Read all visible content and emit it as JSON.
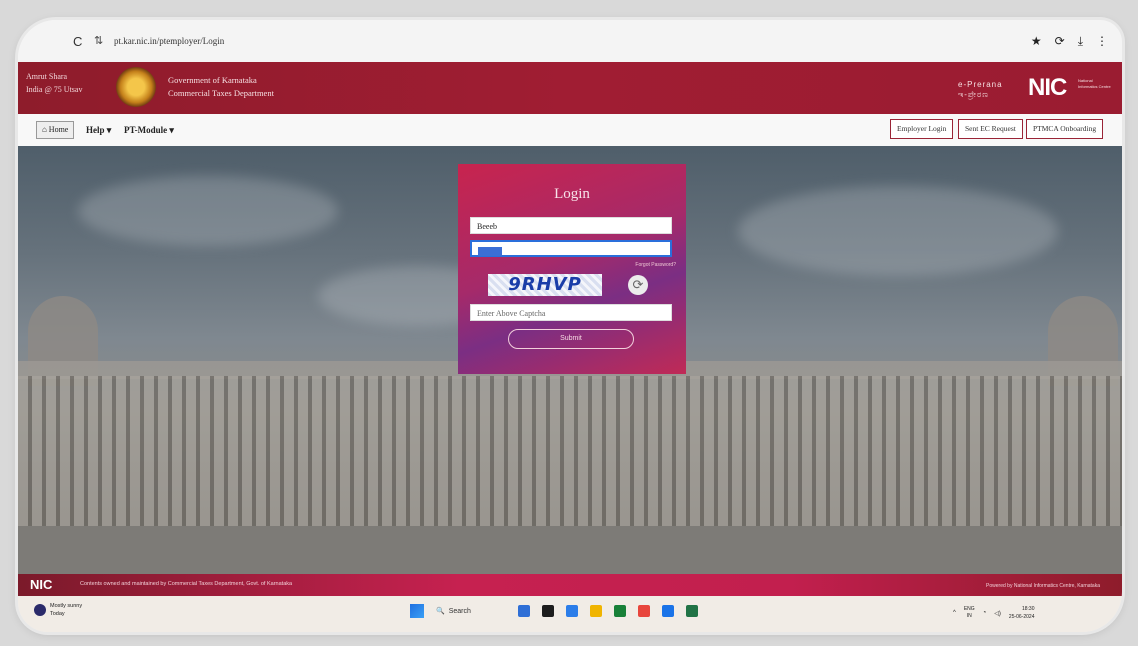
{
  "browser": {
    "reload_glyph": "C",
    "site_info_glyph": "⇅",
    "url": "pt.kar.nic.in/ptemployer/Login",
    "right_icons": [
      "★",
      "⟳",
      "⤓",
      "⋮"
    ]
  },
  "header": {
    "left_line1": "Amrut Shara",
    "left_line2": "India @ 75 Utsav",
    "title_line1": "Government of Karnataka",
    "title_line2": "Commercial Taxes Department",
    "right_line1": "e-Prerana",
    "right_line2": "ಇ-ಪ್ರೇರಣ",
    "nic_logo": "NIC",
    "nic_subtitle": "National Informatics Centre"
  },
  "nav": {
    "home": "⌂ Home",
    "help": "Help ▾",
    "pt_module": "PT-Module ▾",
    "buttons": [
      "Employer Login",
      "Sent EC Request",
      "PTMCA Onboarding"
    ]
  },
  "login": {
    "title": "Login",
    "username_value": "Beeeb",
    "forgot_link": "Forgot Password?",
    "captcha_text": "9RHVP",
    "refresh_glyph": "⟳",
    "captcha_placeholder": "Enter Above Captcha",
    "submit_label": "Submit"
  },
  "footer": {
    "nic": "NIC",
    "text": "Contents owned and maintained by Commercial Taxes Department, Govt. of Karnataka",
    "right": "Powered by National Informatics Centre, Karnataka"
  },
  "taskbar": {
    "weather_line1": "Mostly sunny",
    "weather_line2": "Today",
    "search_label": "Search",
    "lang_line1": "ENG",
    "lang_line2": "IN",
    "time": "18:30",
    "date": "25-06-2024",
    "app_colors": [
      "#2f6fd6",
      "#1d1d1d",
      "#2b7de9",
      "#f0b400",
      "#188038",
      "#e8453c",
      "#1a73e8",
      "#217346"
    ]
  }
}
